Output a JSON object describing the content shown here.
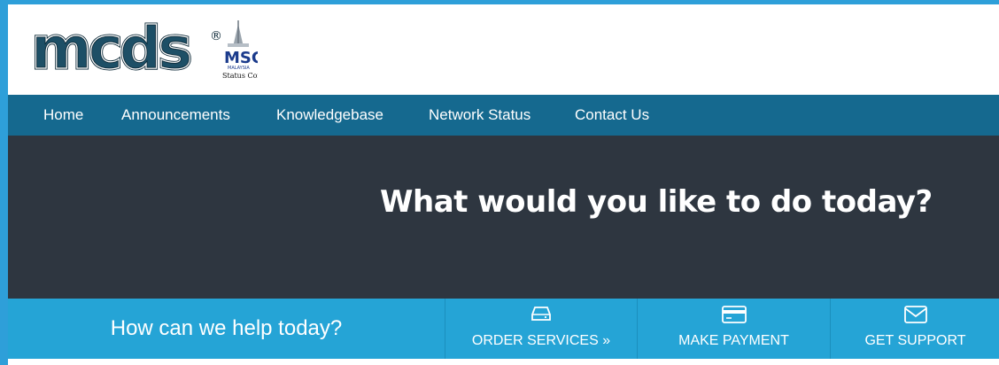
{
  "logo": {
    "brand_text": "mcds",
    "registered_mark": "®",
    "msc_text": "MSC",
    "msc_sub": "MALAYSIA",
    "msc_status": "Status Company"
  },
  "nav": {
    "items": [
      {
        "label": "Home"
      },
      {
        "label": "Announcements"
      },
      {
        "label": "Knowledgebase"
      },
      {
        "label": "Network Status"
      },
      {
        "label": "Contact Us"
      }
    ]
  },
  "hero": {
    "title": "What would you like to do today?"
  },
  "actions": {
    "help_text": "How can we help today?",
    "order_label": "ORDER SERVICES »",
    "payment_label": "MAKE PAYMENT",
    "support_label": "GET SUPPORT"
  },
  "colors": {
    "navbar": "#15698f",
    "hero": "#2e3640",
    "actionbar": "#25a4d6",
    "page_edge": "#2e9fd9"
  }
}
